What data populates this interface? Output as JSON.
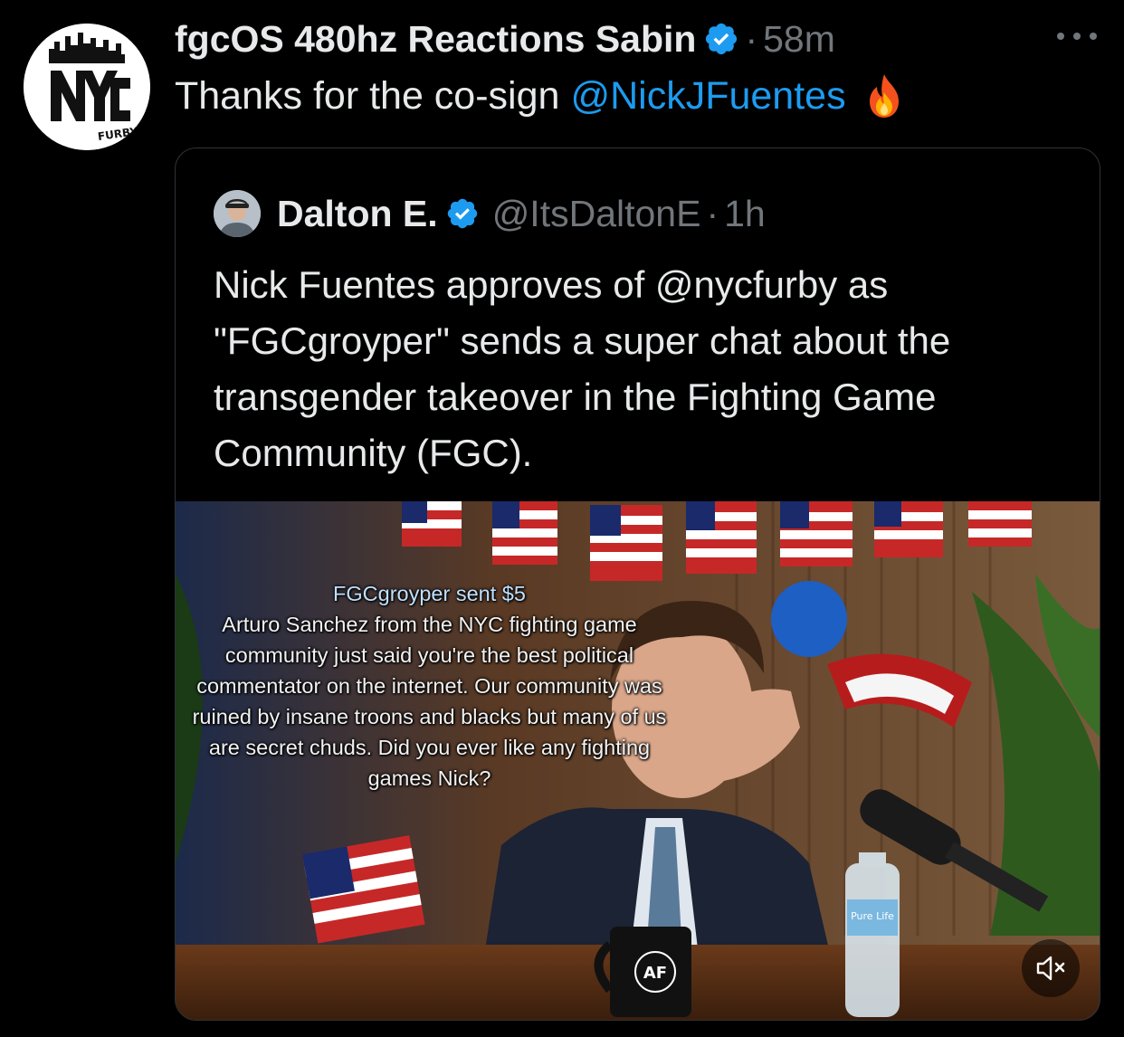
{
  "tweet": {
    "display_name": "fgcOS 480hz Reactions Sabin",
    "separator": "·",
    "time": "58m",
    "text": "Thanks for the co-sign",
    "mention": "@NickJFuentes",
    "avatar_text": "FURBY"
  },
  "quote": {
    "display_name": "Dalton E.",
    "handle": "@ItsDaltonE",
    "separator": "·",
    "time": "1h",
    "text": "Nick Fuentes approves of @nycfurby as \"FGCgroyper\" sends a super chat about the transgender takeover in the Fighting Game Community (FGC)."
  },
  "media": {
    "superchat_user": "FGCgroyper",
    "superchat_amount": "sent $5",
    "superchat_message": "Arturo Sanchez from the NYC fighting game community just said you're the best political commentator on the internet. Our community was ruined by insane troons and blacks but many of us are secret chuds. Did you ever like any fighting games Nick?",
    "mug_text": "AF",
    "bottle_label": "Pure Life"
  },
  "colors": {
    "background": "#000000",
    "text": "#e7e9ea",
    "muted": "#71767b",
    "link": "#1d9bf0",
    "border": "#2f3336"
  },
  "icons": [
    "verified-badge-icon",
    "more-icon",
    "fire-emoji-icon",
    "mute-icon"
  ]
}
